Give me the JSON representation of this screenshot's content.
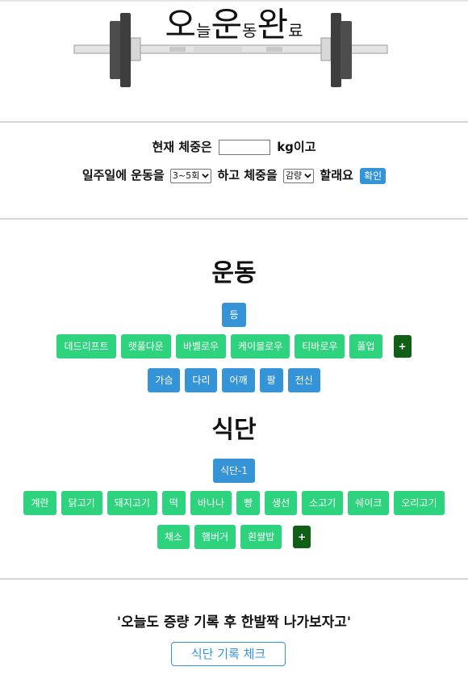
{
  "logo": {
    "parts": [
      "오",
      "늘",
      "운",
      "동",
      "완",
      "료"
    ]
  },
  "form": {
    "line1_prefix": "현재 체중은",
    "weight_value": "",
    "line1_suffix": "kg이고",
    "line2_prefix": "일주일에 운동을",
    "frequency_selected": "3~5회",
    "line2_middle": "하고 체중을",
    "goal_selected": "감량",
    "line2_suffix": "할래요",
    "confirm_label": "확인"
  },
  "exercise": {
    "title": "운동",
    "selected": "등",
    "row1": [
      "데드리프트",
      "랫풀다운",
      "바벨로우",
      "케이블로우",
      "티바로우",
      "풀업"
    ],
    "row2": [
      "가슴",
      "다리",
      "어깨",
      "팔",
      "전신"
    ],
    "add_label": "+"
  },
  "diet": {
    "title": "식단",
    "selected": "식단-1",
    "row1": [
      "계란",
      "닭고기",
      "돼지고기",
      "떡",
      "바나나",
      "빵",
      "생선",
      "소고기",
      "쉐이크",
      "오리고기"
    ],
    "row2": [
      "채소",
      "햄버거",
      "흰쌀밥"
    ],
    "add_label": "+"
  },
  "footer": {
    "quote": "'오늘도 증량 기록 후 한발짝 나가보자고'",
    "check_button": "식단 기록 체크"
  },
  "colors": {
    "primary_blue": "#3594d8",
    "food_green": "#2ed37d",
    "add_dark_green": "#0f5f16"
  }
}
